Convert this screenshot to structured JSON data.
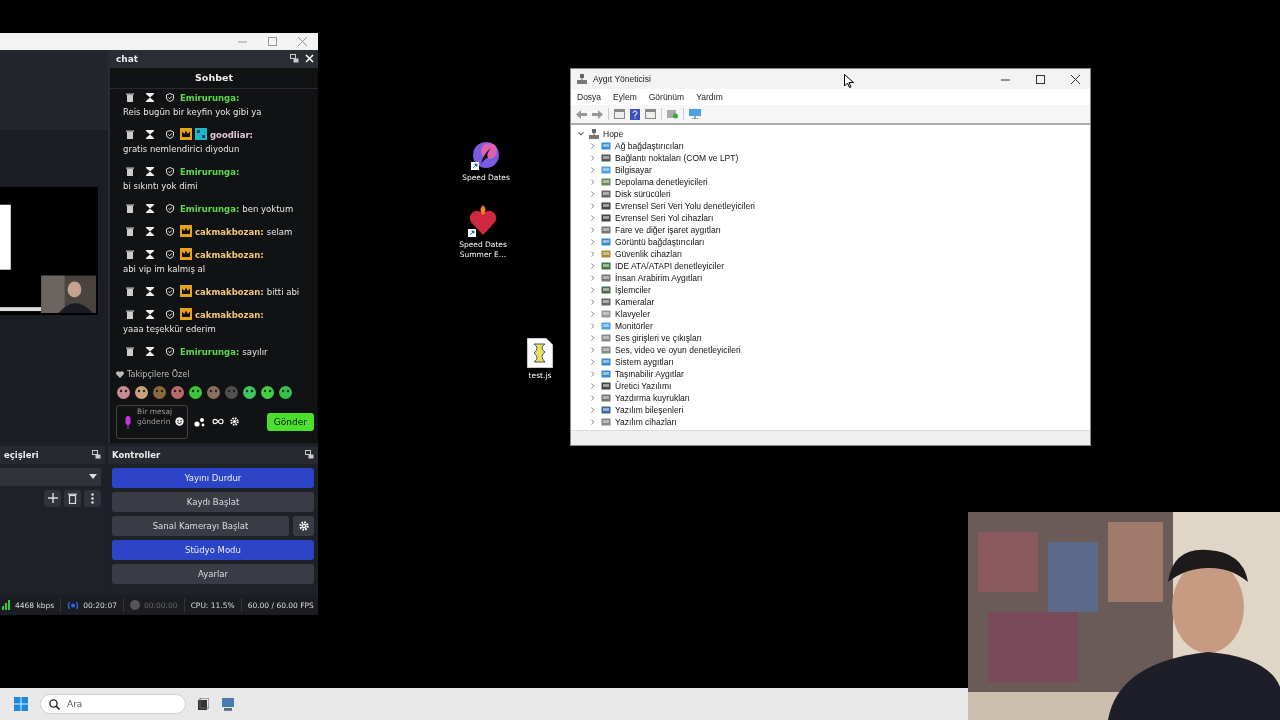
{
  "obs": {
    "chat_dock": {
      "title": "chat",
      "header": "Sohbet",
      "messages": [
        {
          "name": "Emirurunga:",
          "color": "#5cd94a",
          "text": "Reis bugün bir keyfin yok gibi ya"
        },
        {
          "name": "goodliar:",
          "color": "#e2c6d4",
          "badges": [
            {
              "kind": "vip"
            },
            {
              "kind": "partner"
            }
          ],
          "text": "gratis nemlendirici diyodun"
        },
        {
          "name": "Emirurunga:",
          "color": "#5cd94a",
          "text": "bi sıkıntı yok dimi"
        },
        {
          "name": "Emirurunga:",
          "color": "#5cd94a",
          "text": "ben yoktum"
        },
        {
          "name": "cakmakbozan:",
          "color": "#f0c878",
          "badges": [
            {
              "kind": "vip"
            }
          ],
          "text": "selam"
        },
        {
          "name": "cakmakbozan:",
          "color": "#f0c878",
          "badges": [
            {
              "kind": "vip"
            }
          ],
          "text": "abi vip im kalmış al"
        },
        {
          "name": "cakmakbozan:",
          "color": "#f0c878",
          "badges": [
            {
              "kind": "vip"
            }
          ],
          "text": "bitti abi"
        },
        {
          "name": "cakmakbozan:",
          "color": "#f0c878",
          "badges": [
            {
              "kind": "vip"
            }
          ],
          "text": "yaaa teşekkür ederim"
        },
        {
          "name": "Emirurunga:",
          "color": "#5cd94a",
          "text": "sayılır"
        }
      ],
      "followers_only": "Takipçilere Özel",
      "input": {
        "placeholder": "Bir mesaj gönderin"
      },
      "send_button": "Gönder"
    },
    "transitions_dock": {
      "title": "eçişleri"
    },
    "controls_dock": {
      "title": "Kontroller",
      "buttons": [
        {
          "label": "Yayını Durdur",
          "active": true,
          "settings": false
        },
        {
          "label": "Kaydı Başlat",
          "active": false,
          "settings": false
        },
        {
          "label": "Sanal Kamerayı Başlat",
          "active": false,
          "settings": true
        },
        {
          "label": "Stüdyo Modu",
          "active": true,
          "settings": false
        },
        {
          "label": "Ayarlar",
          "active": false,
          "settings": false
        }
      ]
    },
    "status_bar": {
      "bitrate": "4468 kbps",
      "stream_time": "00:20:07",
      "record_time": "00:00:00",
      "recording": false,
      "cpu": "CPU: 11.5%",
      "fps": "60.00 / 60.00 FPS"
    }
  },
  "desktop_icons": [
    {
      "label": "Speed Dates",
      "kind": "flame"
    },
    {
      "label": "Speed Dates Summer E…",
      "kind": "heart"
    },
    {
      "label": "test.js",
      "kind": "script"
    }
  ],
  "device_manager": {
    "title": "Aygıt Yöneticisi",
    "menu": [
      "Dosya",
      "Eylem",
      "Görünüm",
      "Yardım"
    ],
    "tree": {
      "label": "Hope",
      "expanded": true,
      "children": [
        {
          "label": "Ağ bağdaştırıcıları",
          "expanded": false
        },
        {
          "label": "Bağlantı noktaları (COM ve LPT)",
          "expanded": false
        },
        {
          "label": "Bilgisayar",
          "expanded": false
        },
        {
          "label": "Depolama denetleyicileri",
          "expanded": false
        },
        {
          "label": "Disk sürücüleri",
          "expanded": false
        },
        {
          "label": "Evrensel Seri Veri Yolu denetleyicileri",
          "expanded": false
        },
        {
          "label": "Evrensel Seri Yol cihazları",
          "expanded": false
        },
        {
          "label": "Fare ve diğer işaret aygıtları",
          "expanded": false
        },
        {
          "label": "Görüntü bağdaştırıcıları",
          "expanded": false
        },
        {
          "label": "Güvenlik cihazları",
          "expanded": false
        },
        {
          "label": "IDE ATA/ATAPI denetleyiciler",
          "expanded": false
        },
        {
          "label": "İnsan Arabirim Aygıtları",
          "expanded": false
        },
        {
          "label": "İşlemciler",
          "expanded": false
        },
        {
          "label": "Kameralar",
          "expanded": false
        },
        {
          "label": "Klavyeler",
          "expanded": false
        },
        {
          "label": "Monitörler",
          "expanded": false
        },
        {
          "label": "Ses girişleri ve çıkışları",
          "expanded": false
        },
        {
          "label": "Ses, video ve oyun denetleyicileri",
          "expanded": false
        },
        {
          "label": "Sistem aygıtları",
          "expanded": false
        },
        {
          "label": "Taşınabilir Aygıtlar",
          "expanded": false
        },
        {
          "label": "Üretici Yazılımı",
          "expanded": false
        },
        {
          "label": "Yazdırma kuyrukları",
          "expanded": false
        },
        {
          "label": "Yazılım bileşenleri",
          "expanded": false
        },
        {
          "label": "Yazılım cihazları",
          "expanded": false
        }
      ]
    }
  },
  "taskbar": {
    "search": {
      "placeholder": "Ara"
    }
  }
}
